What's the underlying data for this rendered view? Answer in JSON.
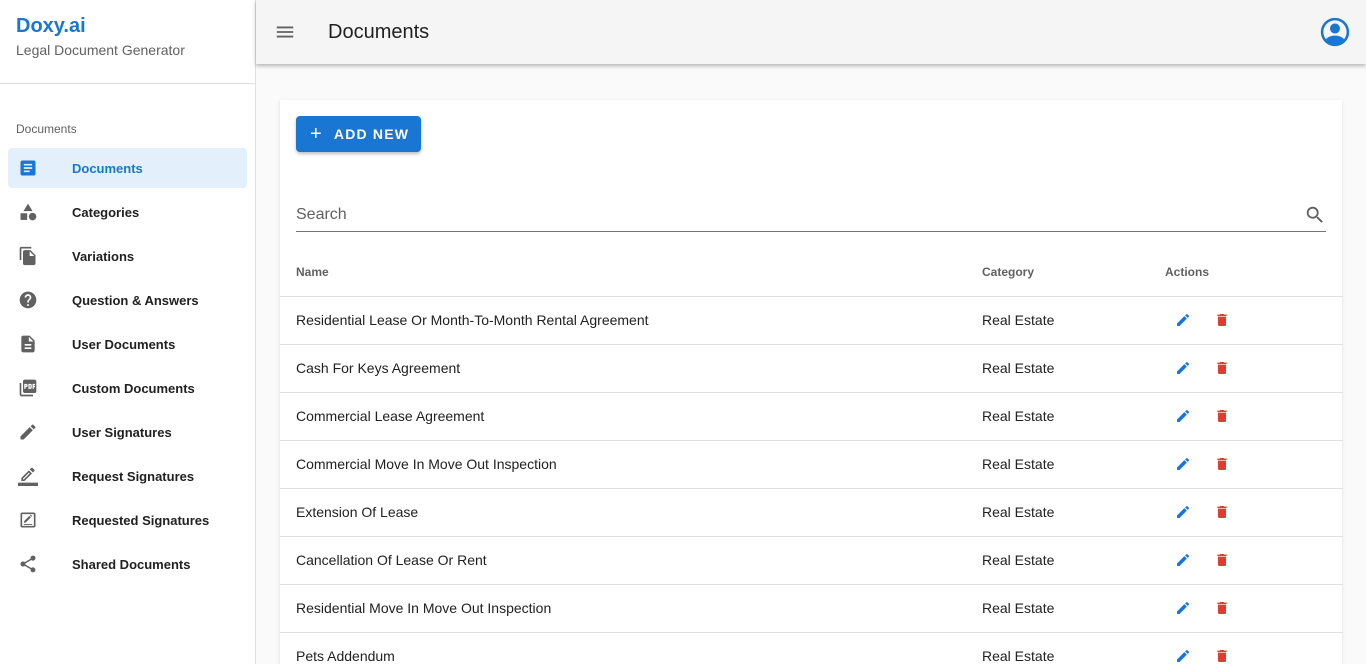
{
  "brand": {
    "title": "Doxy.ai",
    "subtitle": "Legal Document Generator"
  },
  "sidebar": {
    "section_label": "Documents",
    "items": [
      {
        "label": "Documents",
        "icon": "document-icon",
        "active": true
      },
      {
        "label": "Categories",
        "icon": "shapes-icon",
        "active": false
      },
      {
        "label": "Variations",
        "icon": "file-copy-icon",
        "active": false
      },
      {
        "label": "Question & Answers",
        "icon": "help-icon",
        "active": false
      },
      {
        "label": "User Documents",
        "icon": "description-icon",
        "active": false
      },
      {
        "label": "Custom Documents",
        "icon": "pdf-icon",
        "active": false
      },
      {
        "label": "User Signatures",
        "icon": "pencil-icon",
        "active": false
      },
      {
        "label": "Request Signatures",
        "icon": "border-color-icon",
        "active": false
      },
      {
        "label": "Requested Signatures",
        "icon": "signature-doc-icon",
        "active": false
      },
      {
        "label": "Shared Documents",
        "icon": "share-icon",
        "active": false
      }
    ]
  },
  "header": {
    "title": "Documents"
  },
  "toolbar": {
    "add_label": "ADD NEW"
  },
  "search": {
    "placeholder": "Search"
  },
  "table": {
    "columns": [
      "Name",
      "Category",
      "Actions"
    ],
    "rows": [
      {
        "name": "Residential Lease Or Month-To-Month Rental Agreement",
        "category": "Real Estate"
      },
      {
        "name": "Cash For Keys Agreement",
        "category": "Real Estate"
      },
      {
        "name": "Commercial Lease Agreement",
        "category": "Real Estate"
      },
      {
        "name": "Commercial Move In Move Out Inspection",
        "category": "Real Estate"
      },
      {
        "name": "Extension Of Lease",
        "category": "Real Estate"
      },
      {
        "name": "Cancellation Of Lease Or Rent",
        "category": "Real Estate"
      },
      {
        "name": "Residential Move In Move Out Inspection",
        "category": "Real Estate"
      },
      {
        "name": "Pets Addendum",
        "category": "Real Estate"
      }
    ]
  },
  "colors": {
    "primary": "#1976d2",
    "danger": "#e53935",
    "active_bg": "#e3effb"
  }
}
